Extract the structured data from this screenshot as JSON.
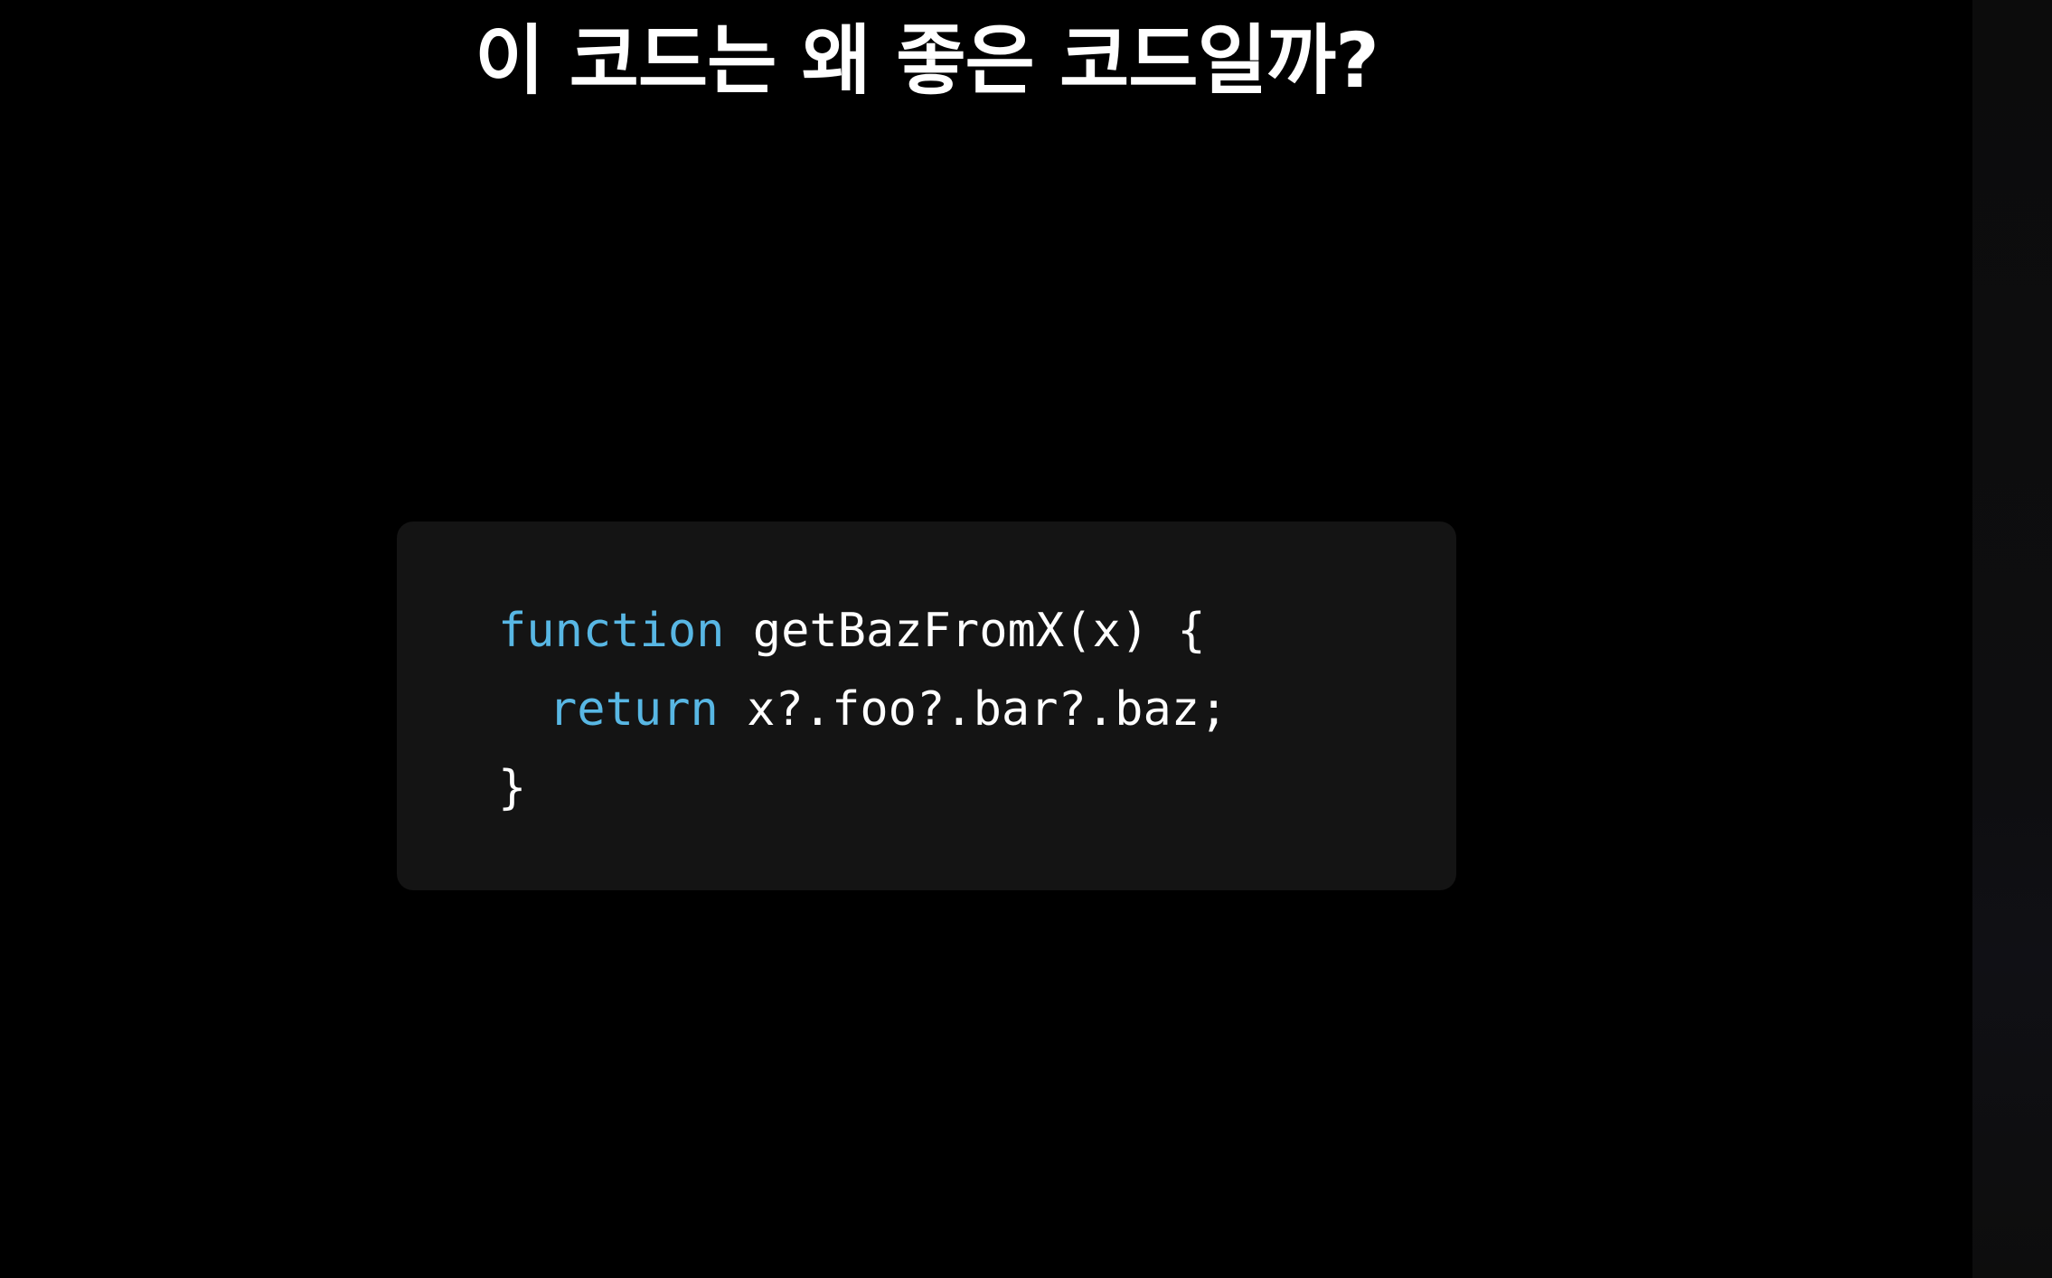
{
  "slide": {
    "title": "이 코드는 왜 좋은 코드일까?"
  },
  "code": {
    "lines": [
      {
        "keyword": "function",
        "rest": " getBazFromX(x) {"
      },
      {
        "keyword": "return",
        "rest": " x?.foo?.bar?.baz;"
      },
      {
        "keyword": "",
        "rest": "}"
      }
    ]
  },
  "colors": {
    "background": "#000000",
    "card": "#141414",
    "keyword": "#58b7e4",
    "text": "#ffffff"
  }
}
